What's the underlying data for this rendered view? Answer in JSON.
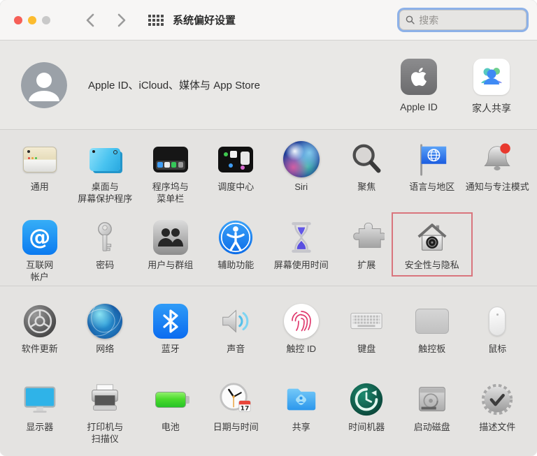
{
  "titlebar": {
    "title": "系统偏好设置",
    "search_placeholder": "搜索"
  },
  "apple_id_section": {
    "summary": "Apple ID、iCloud、媒体与 App Store",
    "shortcuts": [
      {
        "label": "Apple ID",
        "icon": "apple-logo-icon"
      },
      {
        "label": "家人共享",
        "icon": "family-sharing-icon"
      }
    ]
  },
  "grid": {
    "date_day": "17",
    "at_symbol": "@",
    "rows": [
      {
        "items": [
          {
            "label": "通用",
            "icon": "general-window-icon"
          },
          {
            "label": "桌面与\n屏幕保护程序",
            "icon": "desktop-screensaver-icon"
          },
          {
            "label": "程序坞与\n菜单栏",
            "icon": "dock-menubar-icon"
          },
          {
            "label": "调度中心",
            "icon": "mission-control-icon"
          },
          {
            "label": "Siri",
            "icon": "siri-orb-icon"
          },
          {
            "label": "聚焦",
            "icon": "spotlight-magnifier-icon"
          },
          {
            "label": "语言与地区",
            "icon": "language-flag-icon"
          },
          {
            "label": "通知与专注模式",
            "icon": "notification-bell-icon"
          }
        ]
      },
      {
        "items": [
          {
            "label": "互联网\n帐户",
            "icon": "at-sign-icon"
          },
          {
            "label": "密码",
            "icon": "key-icon"
          },
          {
            "label": "用户与群组",
            "icon": "users-groups-icon"
          },
          {
            "label": "辅助功能",
            "icon": "accessibility-icon"
          },
          {
            "label": "屏幕使用时间",
            "icon": "hourglass-icon"
          },
          {
            "label": "扩展",
            "icon": "puzzle-piece-icon"
          },
          {
            "label": "安全性与隐私",
            "icon": "security-house-icon",
            "highlighted": true
          }
        ]
      },
      {
        "items": [
          {
            "label": "软件更新",
            "icon": "software-update-gear-icon"
          },
          {
            "label": "网络",
            "icon": "network-globe-icon"
          },
          {
            "label": "蓝牙",
            "icon": "bluetooth-icon"
          },
          {
            "label": "声音",
            "icon": "speaker-icon"
          },
          {
            "label": "触控 ID",
            "icon": "fingerprint-icon"
          },
          {
            "label": "键盘",
            "icon": "keyboard-icon"
          },
          {
            "label": "触控板",
            "icon": "trackpad-icon"
          },
          {
            "label": "鼠标",
            "icon": "mouse-icon"
          }
        ]
      },
      {
        "items": [
          {
            "label": "显示器",
            "icon": "display-monitor-icon"
          },
          {
            "label": "打印机与\n扫描仪",
            "icon": "printer-icon"
          },
          {
            "label": "电池",
            "icon": "battery-icon"
          },
          {
            "label": "日期与时间",
            "icon": "clock-calendar-icon"
          },
          {
            "label": "共享",
            "icon": "shared-folder-icon"
          },
          {
            "label": "时间机器",
            "icon": "time-machine-icon"
          },
          {
            "label": "启动磁盘",
            "icon": "hard-drive-icon"
          },
          {
            "label": "描述文件",
            "icon": "profile-seal-icon"
          }
        ]
      }
    ]
  },
  "colors": {
    "highlight_box": "#d9757d",
    "accent_blue": "#0b7af0",
    "search_focus_ring": "#8db1e8",
    "traffic_red": "#f65f57",
    "traffic_yellow": "#fcbc2f",
    "traffic_gray": "#c9c9c9"
  }
}
